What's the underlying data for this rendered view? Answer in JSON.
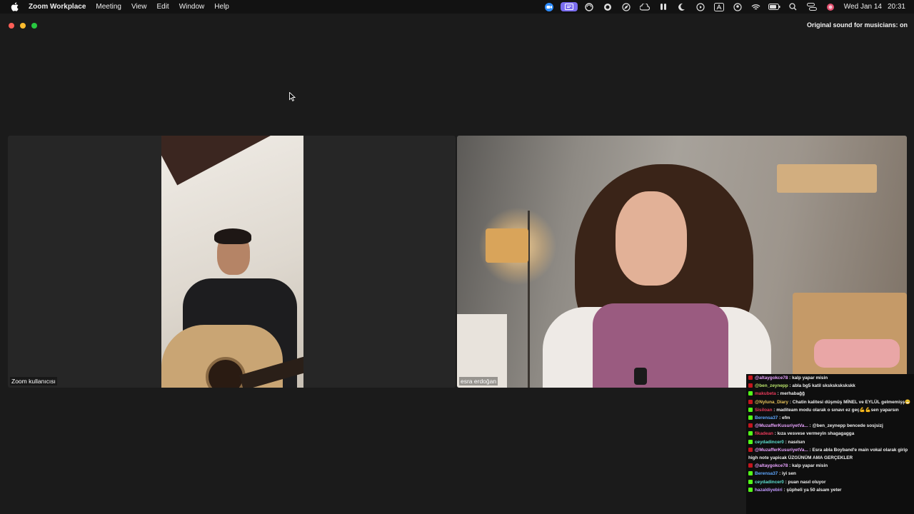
{
  "menubar": {
    "app_name": "Zoom Workplace",
    "menus": [
      "Meeting",
      "View",
      "Edit",
      "Window",
      "Help"
    ],
    "status_icons": [
      "zoom-icon",
      "screen-share-icon",
      "edge-icon",
      "chatgpt-icon",
      "safari-icon",
      "creative-cloud-icon",
      "airpods-icon",
      "focus-moon-icon",
      "play-icon",
      "text-input-icon",
      "user-icon",
      "wifi-icon",
      "battery-icon",
      "search-icon",
      "control-center-icon",
      "siri-icon"
    ],
    "date": "Wed Jan 14",
    "time": "20:31"
  },
  "window": {
    "sound_status": "Original sound for musicians: on"
  },
  "participants": [
    {
      "name": "Zoom kullanıcısı"
    },
    {
      "name": "esra erdoğan"
    }
  ],
  "chat": {
    "top_fragment": "",
    "messages": [
      {
        "badge": "y",
        "user": "@altaygokce78",
        "color": "#e9a3ff",
        "text": " : kalp yapar misin"
      },
      {
        "badge": "y",
        "user": "@ben_zeynepp",
        "color": "#b9e36b",
        "text": " : abla bg5 katil skskskskskskk"
      },
      {
        "badge": "k",
        "user": "makubeta",
        "color": "#e83a5a",
        "text": " : merhabağğ"
      },
      {
        "badge": "y",
        "user": "@Nyluna_Diary",
        "color": "#e6c25b",
        "text": " : Chatin kalitesi düşmüş MİNEL ve EYLÜL gelmemişş😁"
      },
      {
        "badge": "k",
        "user": "Sisiloan",
        "color": "#e83a5a",
        "text": " : maditeam modu olarak o sınavı ez geç💪💪sen yaparsın"
      },
      {
        "badge": "k",
        "user": "Berensa37",
        "color": "#5fa8ff",
        "text": " : efm"
      },
      {
        "badge": "y",
        "user": "@MuzafferKusuriyetVa...",
        "color": "#e9a3ff",
        "text": " : @ben_zeynepp bencede sosjsizj"
      },
      {
        "badge": "k",
        "user": "fikadean",
        "color": "#e83a5a",
        "text": " : kıza vesvese vermeyin shagagagga"
      },
      {
        "badge": "k",
        "user": "ceydadincer0",
        "color": "#5ee0d0",
        "text": " : nasılsın"
      },
      {
        "badge": "y",
        "user": "@MuzafferKusuriyetVa...",
        "color": "#e9a3ff",
        "text": " : Esra abla Boyband'e main vokal olarak girip high note yapicak ÜZGÜNÜM AMA GERÇEKLER"
      },
      {
        "badge": "y",
        "user": "@altaygokce78",
        "color": "#e9a3ff",
        "text": " : kalp yapar misin"
      },
      {
        "badge": "k",
        "user": "Berensa37",
        "color": "#5fa8ff",
        "text": " : iyi sen"
      },
      {
        "badge": "k",
        "user": "ceydadincer0",
        "color": "#5ee0d0",
        "text": " : puan nasıl oluyor"
      },
      {
        "badge": "k",
        "user": "hazaldiyebiri",
        "color": "#c19bff",
        "text": " : şüpheli ya 50 alsam yeter"
      }
    ]
  },
  "colors": {
    "zoom_accent": "#7a6cf0",
    "badge_youtube": "#c3151d",
    "badge_kick": "#53fc18"
  }
}
